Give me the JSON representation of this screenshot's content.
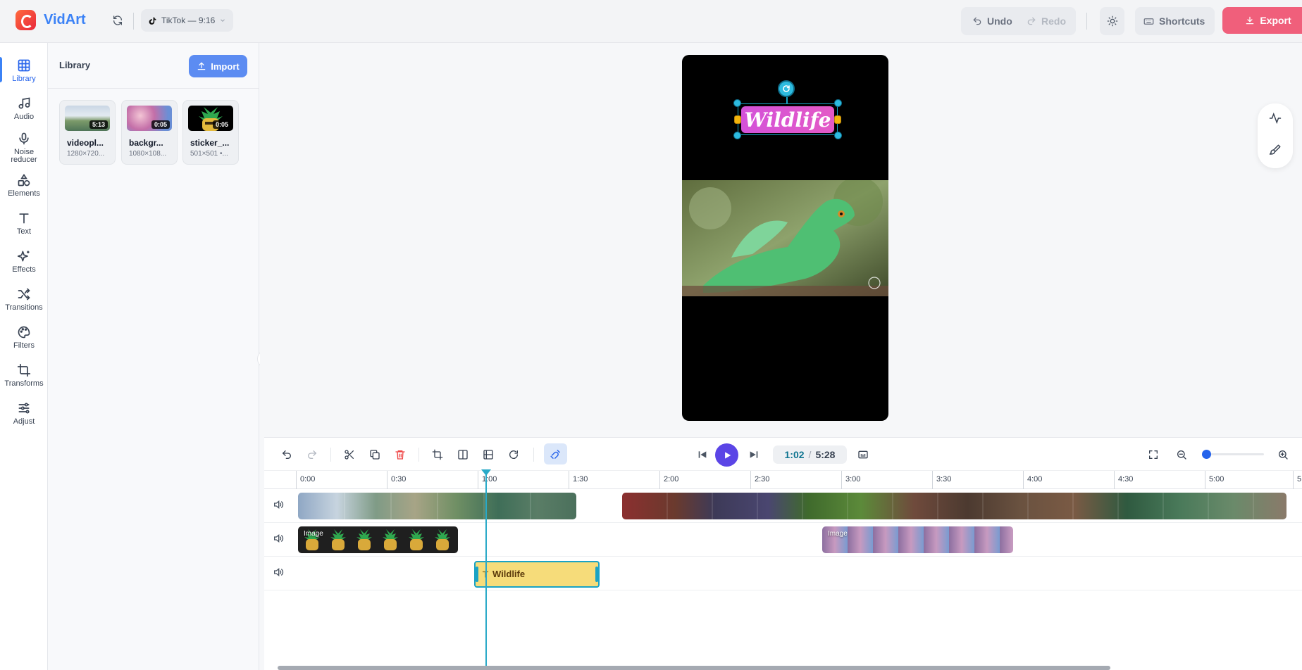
{
  "app": {
    "brand": "VidArt",
    "platform_label": "TikTok — 9:16"
  },
  "toolbar": {
    "undo": "Undo",
    "redo": "Redo",
    "shortcuts": "Shortcuts",
    "export": "Export"
  },
  "rail": [
    {
      "label": "Library",
      "icon": "library-icon",
      "active": true
    },
    {
      "label": "Audio",
      "icon": "music-note-icon"
    },
    {
      "label": "Noise reducer",
      "icon": "microphone-icon"
    },
    {
      "label": "Elements",
      "icon": "shapes-icon"
    },
    {
      "label": "Text",
      "icon": "text-icon"
    },
    {
      "label": "Effects",
      "icon": "sparkles-icon"
    },
    {
      "label": "Transitions",
      "icon": "shuffle-icon"
    },
    {
      "label": "Filters",
      "icon": "palette-icon"
    },
    {
      "label": "Transforms",
      "icon": "crop-icon"
    },
    {
      "label": "Adjust",
      "icon": "sliders-icon"
    }
  ],
  "library": {
    "title": "Library",
    "import": "Import",
    "items": [
      {
        "name": "videopl...",
        "meta": "1280×720...",
        "duration": "5:13"
      },
      {
        "name": "backgr...",
        "meta": "1080×108...",
        "duration": "0:05"
      },
      {
        "name": "sticker_...",
        "meta": "501×501 •...",
        "duration": "0:05"
      }
    ]
  },
  "canvas": {
    "overlay_text": "Wildlife",
    "text_color": "#ffffff",
    "pill_color": "#d452d9"
  },
  "timeline": {
    "current_time": "1:02",
    "separator": "/",
    "total_time": "5:28",
    "ruler": [
      "0:00",
      "0:30",
      "1:00",
      "1:30",
      "2:00",
      "2:30",
      "3:00",
      "3:30",
      "4:00",
      "4:30",
      "5:00",
      "5:"
    ],
    "tracks": [
      {
        "type": "video",
        "clips": [
          {
            "label": ""
          },
          {
            "label": ""
          }
        ]
      },
      {
        "type": "image",
        "clips": [
          {
            "label": "Image"
          },
          {
            "label": "Image"
          }
        ]
      },
      {
        "type": "text",
        "clips": [
          {
            "label": "Wildlife"
          }
        ]
      }
    ]
  },
  "colors": {
    "accent": "#3b82f6",
    "export": "#f05f7b",
    "play": "#5b45e6",
    "playhead": "#2aaac8",
    "text_clip": "#f6dc7a"
  }
}
